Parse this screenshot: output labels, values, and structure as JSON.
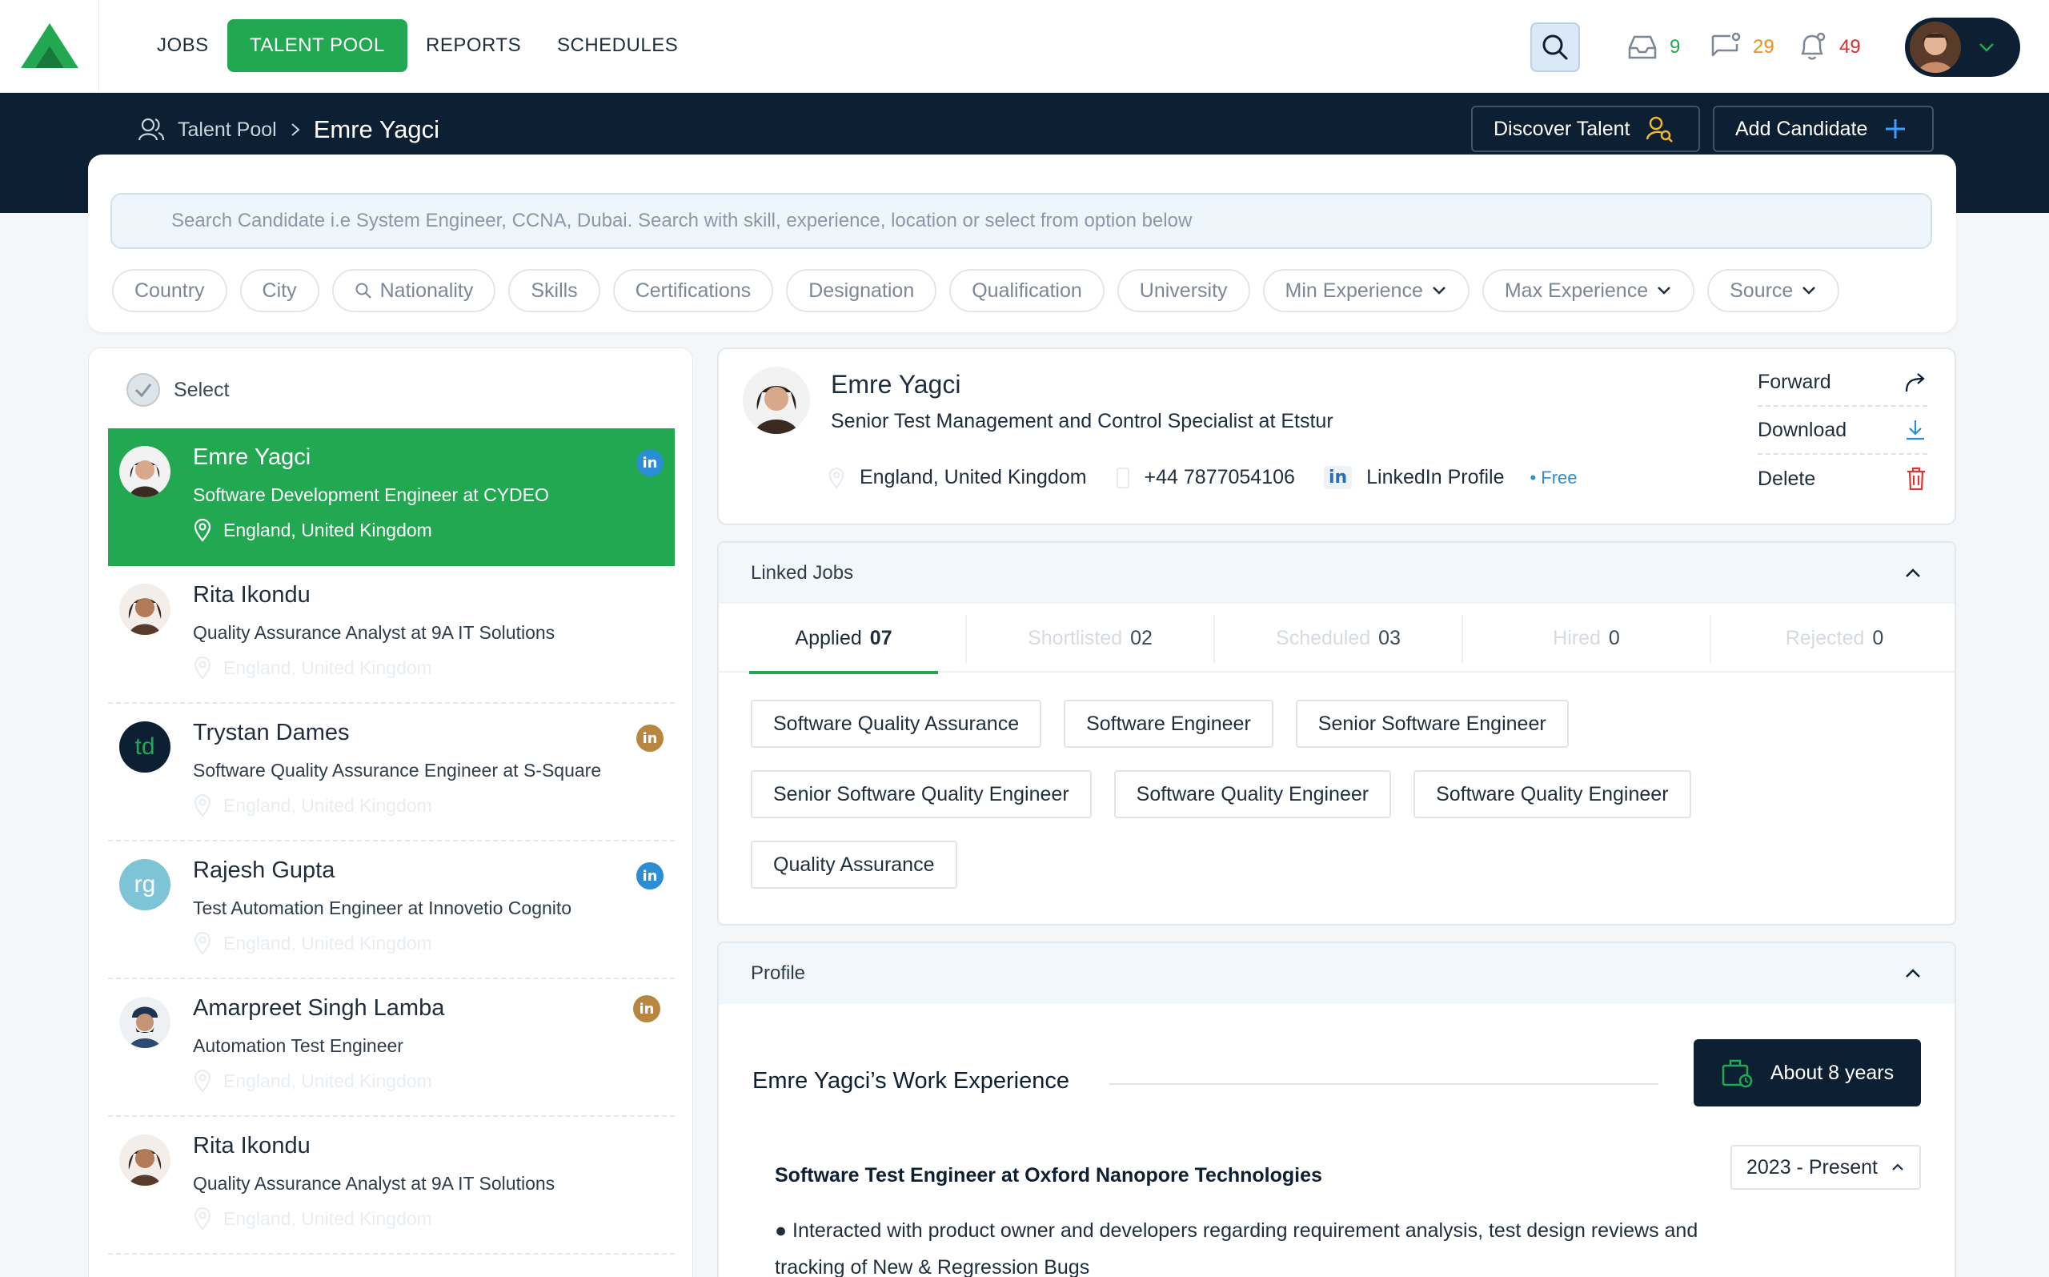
{
  "nav": {
    "items": [
      "JOBS",
      "TALENT POOL",
      "REPORTS",
      "SCHEDULES"
    ],
    "inbox_count": "9",
    "messages_count": "29",
    "notifications_count": "49"
  },
  "breadcrumb": {
    "parent": "Talent Pool",
    "current": "Emre Yagci"
  },
  "header_buttons": {
    "discover": "Discover Talent",
    "add": "Add Candidate"
  },
  "search": {
    "placeholder": "Search Candidate i.e System Engineer, CCNA, Dubai. Search with skill, experience, location or select from option below",
    "filters": [
      "Country",
      "City",
      "Nationality",
      "Skills",
      "Certifications",
      "Designation",
      "Qualification",
      "University",
      "Min Experience",
      "Max Experience",
      "Source"
    ]
  },
  "list": {
    "select_label": "Select",
    "candidates": [
      {
        "name": "Emre Yagci",
        "title": "Software Development Engineer at CYDEO",
        "location": "England, United Kingdom",
        "initials": ""
      },
      {
        "name": "Rita Ikondu",
        "title": "Quality Assurance Analyst at 9A IT Solutions",
        "location": "England, United Kingdom",
        "initials": ""
      },
      {
        "name": "Trystan Dames",
        "title": "Software Quality Assurance Engineer at S-Square",
        "location": "England, United Kingdom",
        "initials": "td"
      },
      {
        "name": "Rajesh Gupta",
        "title": "Test Automation Engineer at Innovetio Cognito",
        "location": "England, United Kingdom",
        "initials": "rg"
      },
      {
        "name": "Amarpreet Singh Lamba",
        "title": "Automation Test Engineer",
        "location": "England, United Kingdom",
        "initials": ""
      },
      {
        "name": "Rita Ikondu",
        "title": "Quality Assurance Analyst at 9A IT Solutions",
        "location": "England, United Kingdom",
        "initials": ""
      }
    ],
    "linkedin_badge": "in"
  },
  "detail": {
    "name": "Emre Yagci",
    "title": "Senior Test Management and Control Specialist at Etstur",
    "location": "England, United Kingdom",
    "phone": "+44 7877054106",
    "linkedin_badge": "in",
    "linkedin": "LinkedIn Profile",
    "linkedin_sep": "•",
    "free": "Free",
    "actions": {
      "forward": "Forward",
      "download": "Download",
      "delete": "Delete"
    }
  },
  "linked_jobs": {
    "header": "Linked Jobs",
    "tabs": [
      {
        "label": "Applied",
        "count": "07"
      },
      {
        "label": "Shortlisted",
        "count": "02"
      },
      {
        "label": "Scheduled",
        "count": "03"
      },
      {
        "label": "Hired",
        "count": "0"
      },
      {
        "label": "Rejected",
        "count": "0"
      }
    ],
    "jobs": [
      "Software Quality Assurance",
      "Software Engineer",
      "Senior Software Engineer",
      "Senior Software Quality Engineer",
      "Software Quality Engineer",
      "Software Quality Engineer",
      "Quality Assurance"
    ]
  },
  "profile": {
    "header": "Profile",
    "work_title": "Emre Yagci’s Work Experience",
    "years": "About 8 years",
    "job": "Software Test Engineer at Oxford Nanopore Technologies",
    "dates": "2023 - Present",
    "bullet": "Interacted with product owner and developers regarding requirement analysis, test design reviews and tracking of New & Regression Bugs"
  },
  "colors": {
    "brand_green": "#22a851",
    "navy": "#0d2033",
    "linkedin_blue": "#2a8dd6",
    "linkedin_gold": "#b8863f"
  }
}
